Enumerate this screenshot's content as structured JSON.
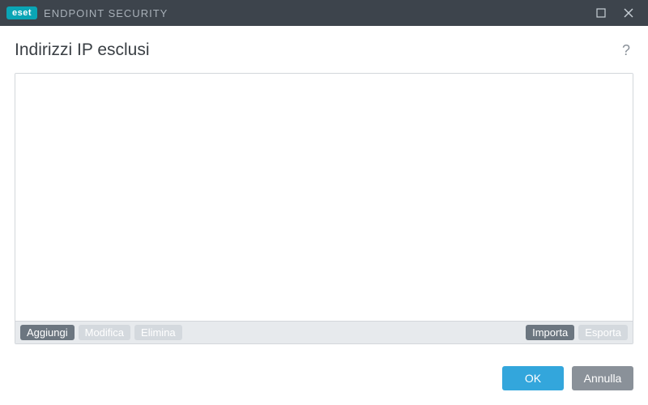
{
  "titlebar": {
    "logo_text": "eset",
    "app_title": "ENDPOINT SECURITY"
  },
  "page": {
    "title": "Indirizzi IP esclusi",
    "help_symbol": "?"
  },
  "list": {
    "items": []
  },
  "toolbar": {
    "add": "Aggiungi",
    "edit": "Modifica",
    "delete": "Elimina",
    "import": "Importa",
    "export": "Esporta"
  },
  "footer": {
    "ok": "OK",
    "cancel": "Annulla"
  }
}
